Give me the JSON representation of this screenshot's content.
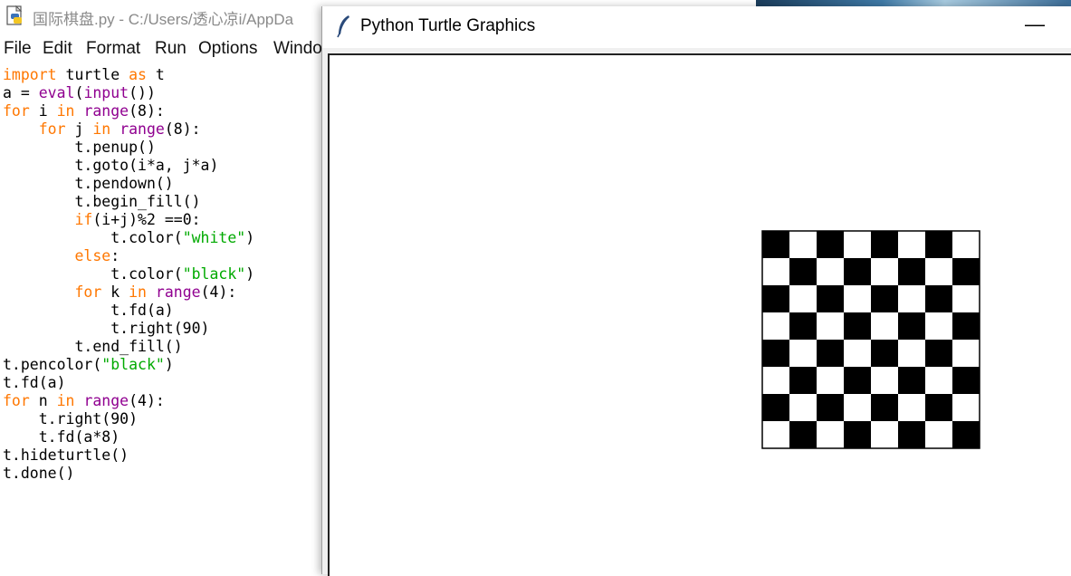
{
  "idle": {
    "title": "国际棋盘.py - C:/Users/透心凉i/AppDa",
    "menu": [
      "File",
      "Edit",
      "Format",
      "Run",
      "Options",
      "Windo"
    ],
    "code": [
      [
        [
          "import",
          "kw"
        ],
        [
          " turtle ",
          ""
        ],
        [
          "as",
          "kw"
        ],
        [
          " t",
          ""
        ]
      ],
      [
        [
          "a = ",
          ""
        ],
        [
          "eval",
          "bi"
        ],
        [
          "(",
          ""
        ],
        [
          "input",
          "bi"
        ],
        [
          "())",
          ""
        ]
      ],
      [
        [
          "for",
          "kw"
        ],
        [
          " i ",
          ""
        ],
        [
          "in",
          "kw"
        ],
        [
          " ",
          ""
        ],
        [
          "range",
          "bi"
        ],
        [
          "(8):",
          ""
        ]
      ],
      [
        [
          "    ",
          ""
        ],
        [
          "for",
          "kw"
        ],
        [
          " j ",
          ""
        ],
        [
          "in",
          "kw"
        ],
        [
          " ",
          ""
        ],
        [
          "range",
          "bi"
        ],
        [
          "(8):",
          ""
        ]
      ],
      [
        [
          "        t.penup()",
          ""
        ]
      ],
      [
        [
          "        t.goto(i*a, j*a)",
          ""
        ]
      ],
      [
        [
          "        t.pendown()",
          ""
        ]
      ],
      [
        [
          "        t.begin_fill()",
          ""
        ]
      ],
      [
        [
          "        ",
          ""
        ],
        [
          "if",
          "kw"
        ],
        [
          "(i+j)%2 ==0:",
          ""
        ]
      ],
      [
        [
          "            t.color(",
          ""
        ],
        [
          "\"white\"",
          "st"
        ],
        [
          ")",
          ""
        ]
      ],
      [
        [
          "        ",
          ""
        ],
        [
          "else",
          "kw"
        ],
        [
          ":",
          ""
        ]
      ],
      [
        [
          "            t.color(",
          ""
        ],
        [
          "\"black\"",
          "st"
        ],
        [
          ")",
          ""
        ]
      ],
      [
        [
          "        ",
          ""
        ],
        [
          "for",
          "kw"
        ],
        [
          " k ",
          ""
        ],
        [
          "in",
          "kw"
        ],
        [
          " ",
          ""
        ],
        [
          "range",
          "bi"
        ],
        [
          "(4):",
          ""
        ]
      ],
      [
        [
          "            t.fd(a)",
          ""
        ]
      ],
      [
        [
          "            t.right(90)",
          ""
        ]
      ],
      [
        [
          "        t.end_fill()",
          ""
        ]
      ],
      [
        [
          "t.pencolor(",
          ""
        ],
        [
          "\"black\"",
          "st"
        ],
        [
          ")",
          ""
        ]
      ],
      [
        [
          "t.fd(a)",
          ""
        ]
      ],
      [
        [
          "for",
          "kw"
        ],
        [
          " n ",
          ""
        ],
        [
          "in",
          "kw"
        ],
        [
          " ",
          ""
        ],
        [
          "range",
          "bi"
        ],
        [
          "(4):",
          ""
        ]
      ],
      [
        [
          "    t.right(90)",
          ""
        ]
      ],
      [
        [
          "    t.fd(a*8)",
          ""
        ]
      ],
      [
        [
          "t.hideturtle()",
          ""
        ]
      ],
      [
        [
          "t.done()",
          ""
        ]
      ]
    ]
  },
  "turtle": {
    "title": "Python Turtle Graphics",
    "minimize": "—",
    "board": {
      "rows": 8,
      "cols": 8,
      "dark_color": "#000000",
      "light_color": "#ffffff",
      "border_color": "#000000"
    }
  },
  "colors": {
    "keyword": "#ff7700",
    "builtin": "#900090",
    "string": "#00aa00"
  }
}
